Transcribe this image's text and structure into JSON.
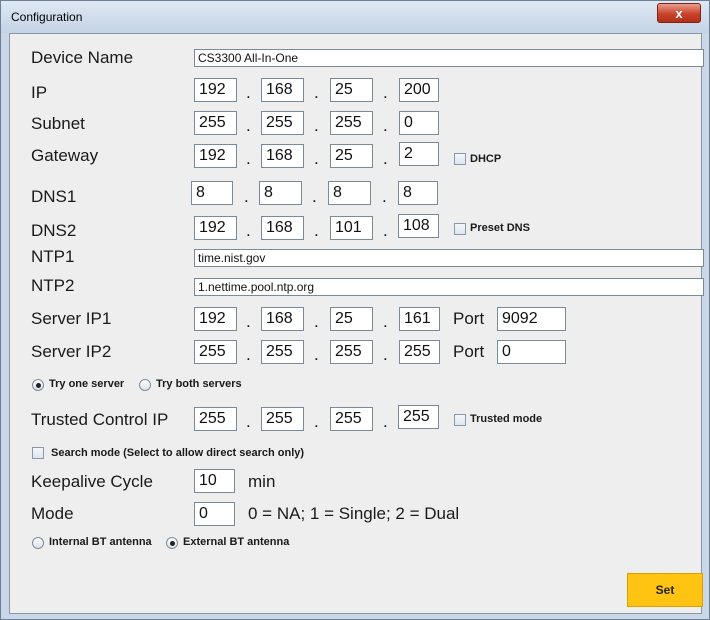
{
  "window": {
    "title": "Configuration",
    "close_glyph": "x"
  },
  "labels": {
    "device_name": "Device Name",
    "ip": "IP",
    "subnet": "Subnet",
    "gateway": "Gateway",
    "dns1": "DNS1",
    "dns2": "DNS2",
    "ntp1": "NTP1",
    "ntp2": "NTP2",
    "server_ip1": "Server IP1",
    "server_ip2": "Server IP2",
    "trusted_control_ip": "Trusted Control IP",
    "keepalive_cycle": "Keepalive Cycle",
    "mode": "Mode",
    "port": "Port",
    "min": "min",
    "mode_hint": "0 = NA; 1 = Single; 2 = Dual",
    "separator": "."
  },
  "fields": {
    "device_name": "CS3300 All-In-One",
    "ip": [
      "192",
      "168",
      "25",
      "200"
    ],
    "subnet": [
      "255",
      "255",
      "255",
      "0"
    ],
    "gateway": [
      "192",
      "168",
      "25",
      "2"
    ],
    "dns1": [
      "8",
      "8",
      "8",
      "8"
    ],
    "dns2": [
      "192",
      "168",
      "101",
      "108"
    ],
    "ntp1": "time.nist.gov",
    "ntp2": "1.nettime.pool.ntp.org",
    "server_ip1": [
      "192",
      "168",
      "25",
      "161"
    ],
    "server_ip1_port": "9092",
    "server_ip2": [
      "255",
      "255",
      "255",
      "255"
    ],
    "server_ip2_port": "0",
    "trusted_control_ip": [
      "255",
      "255",
      "255",
      "255"
    ],
    "keepalive_cycle": "10",
    "mode": "0"
  },
  "checkboxes": {
    "dhcp": {
      "label": "DHCP",
      "checked": false
    },
    "preset_dns": {
      "label": "Preset DNS",
      "checked": false
    },
    "trusted_mode": {
      "label": "Trusted mode",
      "checked": false
    },
    "search_mode": {
      "label": "Search mode (Select to allow direct search only)",
      "checked": false
    }
  },
  "radios": {
    "server_mode": {
      "options": [
        "Try one server",
        "Try both servers"
      ],
      "selected": "Try one server"
    },
    "antenna": {
      "options": [
        "Internal BT antenna",
        "External BT antenna"
      ],
      "selected": "External BT antenna"
    }
  },
  "buttons": {
    "set": "Set"
  },
  "colors": {
    "set_button": "#ffc312",
    "close_button": "#c8432b"
  }
}
